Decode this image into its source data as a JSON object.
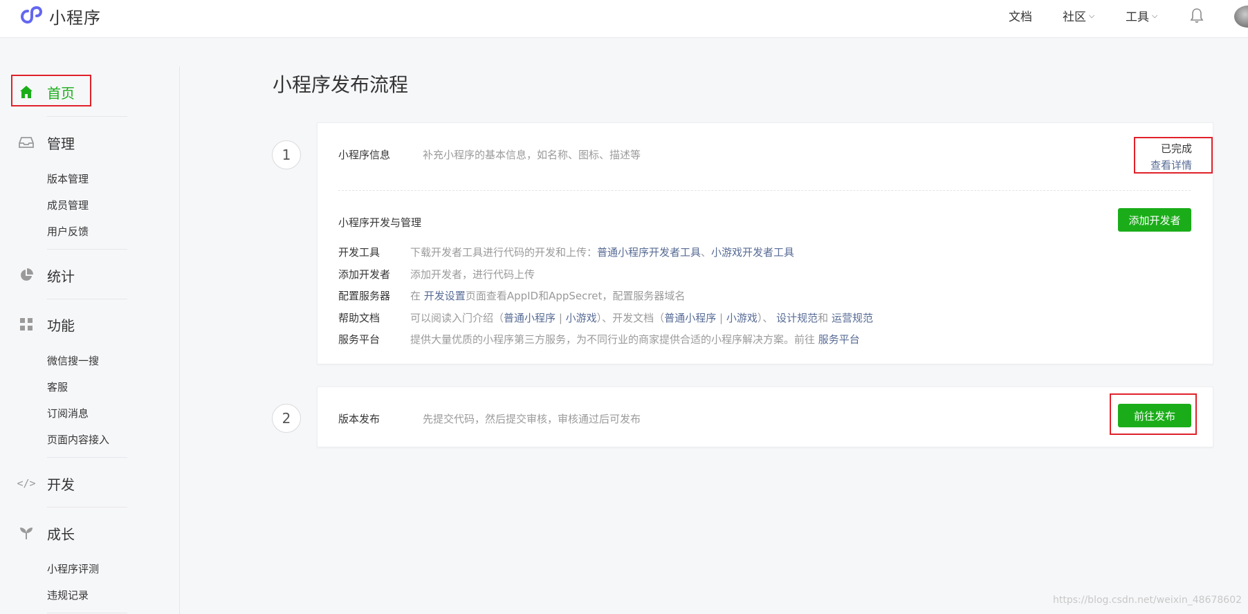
{
  "header": {
    "logo_text": "小程序",
    "nav": [
      {
        "label": "文档"
      },
      {
        "label": "社区",
        "caret": "⌵"
      },
      {
        "label": "工具",
        "caret": "⌵"
      }
    ]
  },
  "sidebar": {
    "home": "首页",
    "manage": {
      "label": "管理",
      "items": [
        "版本管理",
        "成员管理",
        "用户反馈"
      ]
    },
    "stats": {
      "label": "统计"
    },
    "features": {
      "label": "功能",
      "items": [
        "微信搜一搜",
        "客服",
        "订阅消息",
        "页面内容接入"
      ]
    },
    "develop": {
      "label": "开发",
      "icon_text": "</>"
    },
    "growth": {
      "label": "成长",
      "items": [
        "小程序评测",
        "违规记录"
      ]
    }
  },
  "main": {
    "title": "小程序发布流程",
    "step1": {
      "number": "1",
      "info_title": "小程序信息",
      "info_desc": "补充小程序的基本信息，如名称、图标、描述等",
      "status": "已完成",
      "detail_link": "查看详情",
      "dev_title": "小程序开发与管理",
      "add_dev_button": "添加开发者",
      "rows": {
        "tools": {
          "key": "开发工具",
          "text": "下载开发者工具进行代码的开发和上传：",
          "link1": "普通小程序开发者工具",
          "sep": "、",
          "link2": "小游戏开发者工具"
        },
        "add_dev": {
          "key": "添加开发者",
          "text": "添加开发者，进行代码上传"
        },
        "server": {
          "key": "配置服务器",
          "pre": "在",
          "link": "开发设置",
          "post": "页面查看AppID和AppSecret，配置服务器域名"
        },
        "help": {
          "key": "帮助文档",
          "pre": "可以阅读入门介绍（",
          "link1": "普通小程序",
          "bar1": "|",
          "link2": "小游戏",
          "mid": "）、开发文档（",
          "link3": "普通小程序",
          "bar2": "|",
          "link4": "小游戏",
          "mid2": "）、",
          "link5": "设计规范",
          "and": "和",
          "link6": "运营规范"
        },
        "platform": {
          "key": "服务平台",
          "text": "提供大量优质的小程序第三方服务，为不同行业的商家提供合适的小程序解决方案。前往",
          "link": "服务平台"
        }
      }
    },
    "step2": {
      "number": "2",
      "title": "版本发布",
      "desc": "先提交代码，然后提交审核，审核通过后可发布",
      "publish_button": "前往发布"
    }
  },
  "watermark": "https://blog.csdn.net/weixin_48678602",
  "colors": {
    "accent_green": "#1aad19",
    "link_blue": "#576b95",
    "highlight_red": "#e0202a"
  }
}
